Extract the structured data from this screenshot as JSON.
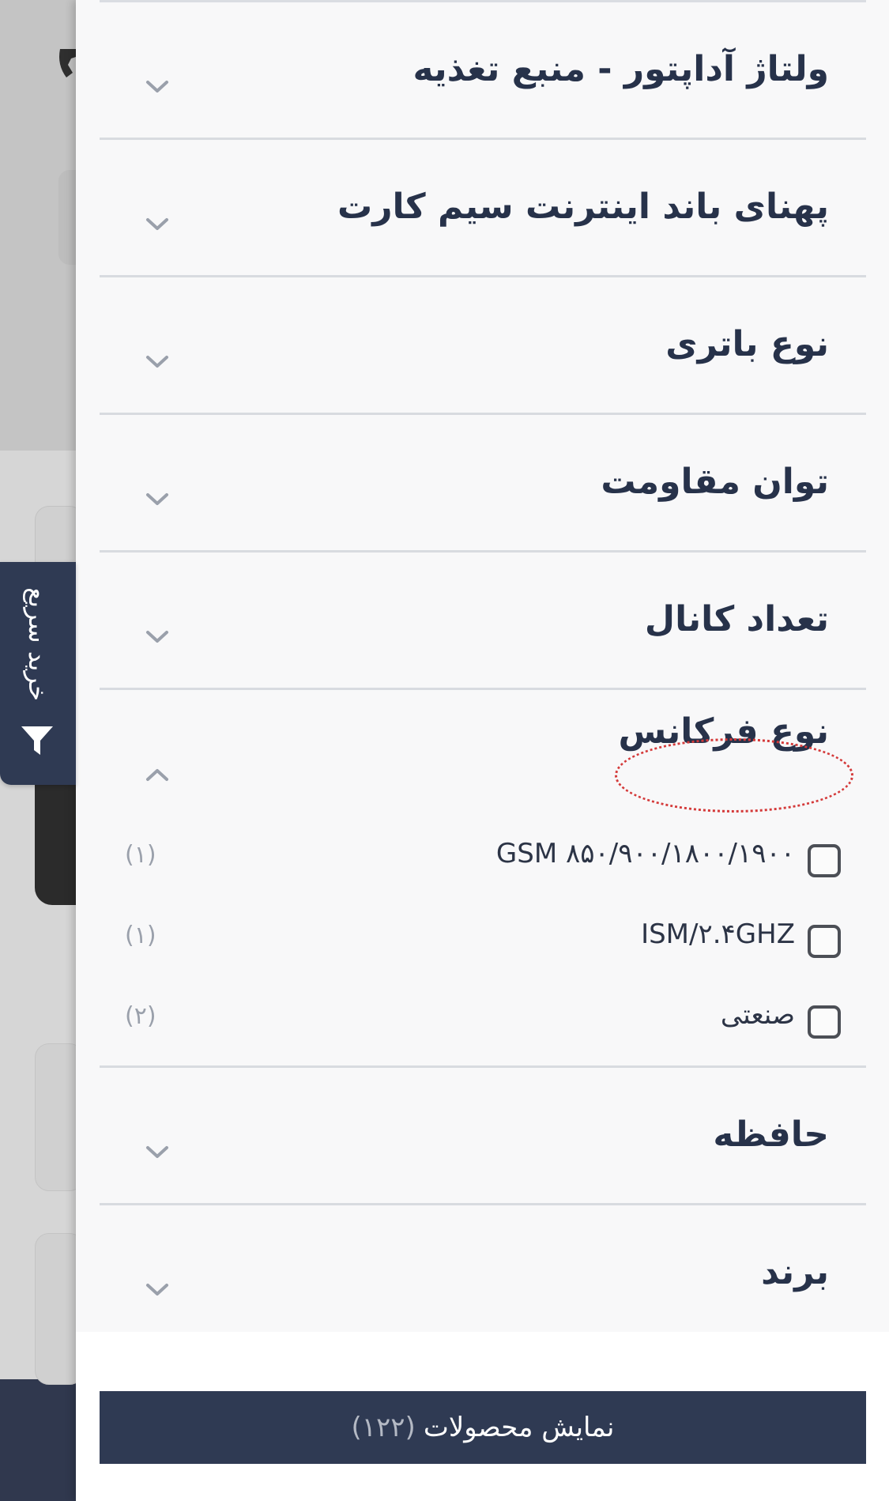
{
  "quick_buy": {
    "label": "خرید سریع",
    "icon": "funnel-icon"
  },
  "filters": [
    {
      "title": "ولتاژ آداپتور - منبع تغذیه",
      "expanded": false
    },
    {
      "title": "پهنای باند اینترنت سیم کارت",
      "expanded": false
    },
    {
      "title": "نوع باتری",
      "expanded": false
    },
    {
      "title": "توان مقاومت",
      "expanded": false
    },
    {
      "title": "تعداد کانال",
      "expanded": false
    },
    {
      "title": "نوع فرکانس",
      "expanded": true,
      "options": [
        {
          "label": "GSM ۸۵۰/۹۰۰/۱۸۰۰/۱۹۰۰",
          "count": "(۱)",
          "checked": false
        },
        {
          "label": "ISM/۲.۴GHZ",
          "count": "(۱)",
          "checked": false
        },
        {
          "label": "صنعتی",
          "count": "(۲)",
          "checked": false
        }
      ]
    },
    {
      "title": "حافظه",
      "expanded": false
    },
    {
      "title": "برند",
      "expanded": false
    }
  ],
  "footer": {
    "show_label": "نمایش محصولات",
    "show_count": "(۱۲۲)"
  },
  "colors": {
    "primary": "#2f3a53",
    "highlight_circle": "#d43a3a"
  }
}
